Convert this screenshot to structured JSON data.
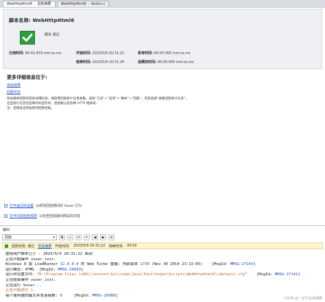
{
  "tabs": [
    {
      "label": "WebHttpHtml6",
      "sub": "回放摘要",
      "active": true
    },
    {
      "label": "WebHttpHtml6",
      "sub": "Action.c",
      "active": false
    }
  ],
  "summary": {
    "script_label": "脚本名称:",
    "script_name": "WebHttpHtml6",
    "pass_text": "脚本 通过",
    "stats": {
      "elapsed_label": "已用时间:",
      "elapsed_value": "00:02.433 mm:ss.ms",
      "start_label": "开始时间:",
      "start_value": "2023/5/9 20:31:22",
      "think_label": "思考时间:",
      "think_value": "00:00.000 mm:ss.ms",
      "end_label": "结束时间:",
      "end_value": "2023/5/9 20:31:24",
      "wasted_label": "浪费的时间:",
      "wasted_value": "00:00.000 mm:ss.ms"
    }
  },
  "details": {
    "heading": "更多详细信息位于:",
    "link1": "测试结果",
    "link2": "回放日志",
    "notes": [
      "有关脚本回放的其他详细信息，请启用回放统计信息收集。选择“工具”>“选项”>“脚本”>“回放”，然后选择“收集回放统计信息”。",
      "这些统计信息包括事务响应时间、连接数以及各种 HTTP 相关项。",
      "注：启用此选项会影响回放性能。"
    ]
  },
  "bottom_links": [
    {
      "link": "打开运行时设置",
      "text": "以修改回放期间的 Vuser 行为"
    },
    {
      "link": "打开内容检查规则",
      "text": "以检查回放期间网站的内容"
    }
  ],
  "output": {
    "title": "输出",
    "filter_value": "回放",
    "status_passed": "回放状态: 通过",
    "status_view_summary": "查看摘要",
    "status_start_label": "开始时间:",
    "status_start_value": "2023/5/9 20:31:22",
    "status_duration_label": "持续时间:",
    "status_duration_value": "00:02",
    "log": [
      {
        "parts": [
          {
            "t": "虚拟用户脚本已于 : 2023/5/9 20:31:22 启动"
          }
        ]
      },
      {
        "parts": [
          {
            "t": "正在开始操作 vuser_init."
          }
        ]
      },
      {
        "parts": [
          {
            "t": "Windows 8 版 LoadRunner "
          },
          {
            "t": "12.0.0.0",
            "c": "num"
          },
          {
            "t": " 的 Web Turbo 重播; 内部版本 "
          },
          {
            "t": "2739",
            "c": "num"
          },
          {
            "t": " (Nov 30 2014 23:13:05)    [MsgId: "
          },
          {
            "t": "MMSG-27143",
            "c": "num"
          },
          {
            "t": "]"
          }
        ]
      },
      {
        "parts": [
          {
            "t": "运行模式: HTML  [MsgId: "
          },
          {
            "t": "MMSG-26993",
            "c": "num"
          },
          {
            "t": "]"
          }
        ]
      },
      {
        "parts": [
          {
            "t": "运行时设置文件: \""
          },
          {
            "t": "D:\\Program Files (x86)\\tencent\\Git\\code\\Java\\Test\\VuGen\\Scripts\\WebHttpHtml6\\\\default.cfg",
            "c": "orange"
          },
          {
            "t": "\"    [MsgId: "
          },
          {
            "t": "MMSG-27141",
            "c": "num"
          },
          {
            "t": "]"
          }
        ]
      },
      {
        "parts": [
          {
            "t": "正在结束操作 vuser_init."
          }
        ]
      },
      {
        "parts": [
          {
            "t": "正在运行 Vuser..."
          }
        ]
      },
      {
        "parts": [
          {
            "t": "正在开始迭代 1.",
            "c": "orange"
          }
        ]
      },
      {
        "parts": [
          {
            "t": "每个服务器的最大并发连接数: "
          },
          {
            "t": "6",
            "c": "num"
          },
          {
            "t": "     [MsgId: "
          },
          {
            "t": "MMSG-26989",
            "c": "num"
          },
          {
            "t": "]"
          }
        ]
      }
    ]
  },
  "watermark": "CSDN @一言不合就撸脚",
  "colors": {
    "pass_green": "#2e9e3a",
    "link_blue": "#1a55c8",
    "status_bg": "#fdf5d2"
  }
}
